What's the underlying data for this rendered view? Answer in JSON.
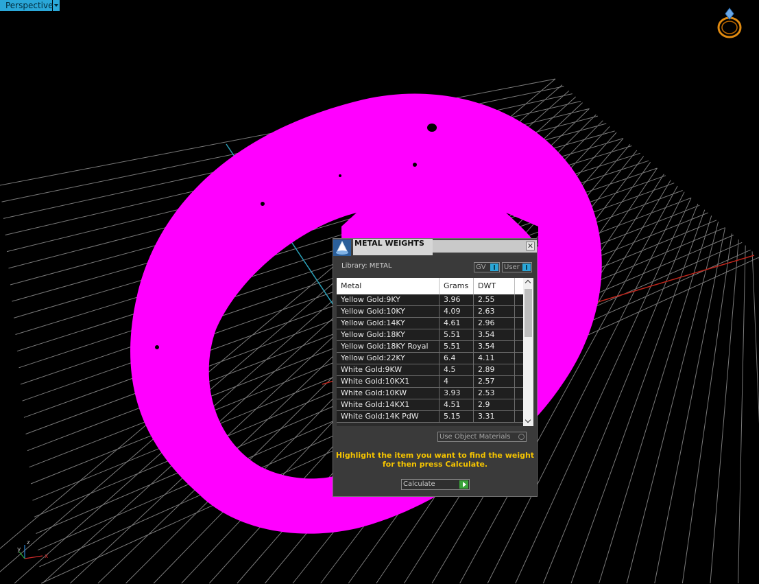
{
  "viewport": {
    "label": "Perspective",
    "axes": {
      "x": "x",
      "y": "y",
      "z": "z"
    },
    "colors": {
      "background": "#000000",
      "ring": "#ff00ff",
      "grid": "#7a7a7a",
      "x_axis": "#c0261c",
      "y_axis": "#2aa0b8"
    }
  },
  "dialog": {
    "title": "METAL WEIGHTS",
    "library_label": "Library: METAL",
    "toggles": {
      "gv": "GV",
      "user": "User"
    },
    "table": {
      "columns": [
        "Metal",
        "Grams",
        "DWT"
      ],
      "rows": [
        [
          "Yellow Gold:9KY",
          "3.96",
          "2.55"
        ],
        [
          "Yellow Gold:10KY",
          "4.09",
          "2.63"
        ],
        [
          "Yellow Gold:14KY",
          "4.61",
          "2.96"
        ],
        [
          "Yellow Gold:18KY",
          "5.51",
          "3.54"
        ],
        [
          "Yellow Gold:18KY Royal",
          "5.51",
          "3.54"
        ],
        [
          "Yellow Gold:22KY",
          "6.4",
          "4.11"
        ],
        [
          "White Gold:9KW",
          "4.5",
          "2.89"
        ],
        [
          "White Gold:10KX1",
          "4",
          "2.57"
        ],
        [
          "White Gold:10KW",
          "3.93",
          "2.53"
        ],
        [
          "White Gold:14KX1",
          "4.51",
          "2.9"
        ],
        [
          "White Gold:14K PdW",
          "5.15",
          "3.31"
        ]
      ]
    },
    "use_object_materials": "Use Object Materials",
    "hint": "Highlight the item you want to find the weight for then press Calculate.",
    "calculate": "Calculate",
    "accent_color": "#2aa7d8",
    "hint_color": "#f5c400"
  }
}
